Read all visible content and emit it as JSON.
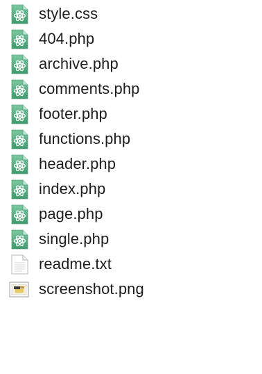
{
  "files": [
    {
      "name": "style.css",
      "icon": "atom-file-icon"
    },
    {
      "name": "404.php",
      "icon": "atom-file-icon"
    },
    {
      "name": "archive.php",
      "icon": "atom-file-icon"
    },
    {
      "name": "comments.php",
      "icon": "atom-file-icon"
    },
    {
      "name": "footer.php",
      "icon": "atom-file-icon"
    },
    {
      "name": "functions.php",
      "icon": "atom-file-icon"
    },
    {
      "name": "header.php",
      "icon": "atom-file-icon"
    },
    {
      "name": "index.php",
      "icon": "atom-file-icon"
    },
    {
      "name": "page.php",
      "icon": "atom-file-icon"
    },
    {
      "name": "single.php",
      "icon": "atom-file-icon"
    },
    {
      "name": "readme.txt",
      "icon": "text-file-icon"
    },
    {
      "name": "screenshot.png",
      "icon": "image-file-icon"
    }
  ],
  "colors": {
    "atom_green_light": "#7cc9a0",
    "atom_green_dark": "#3f9a6c",
    "text": "#1e1e1e"
  }
}
